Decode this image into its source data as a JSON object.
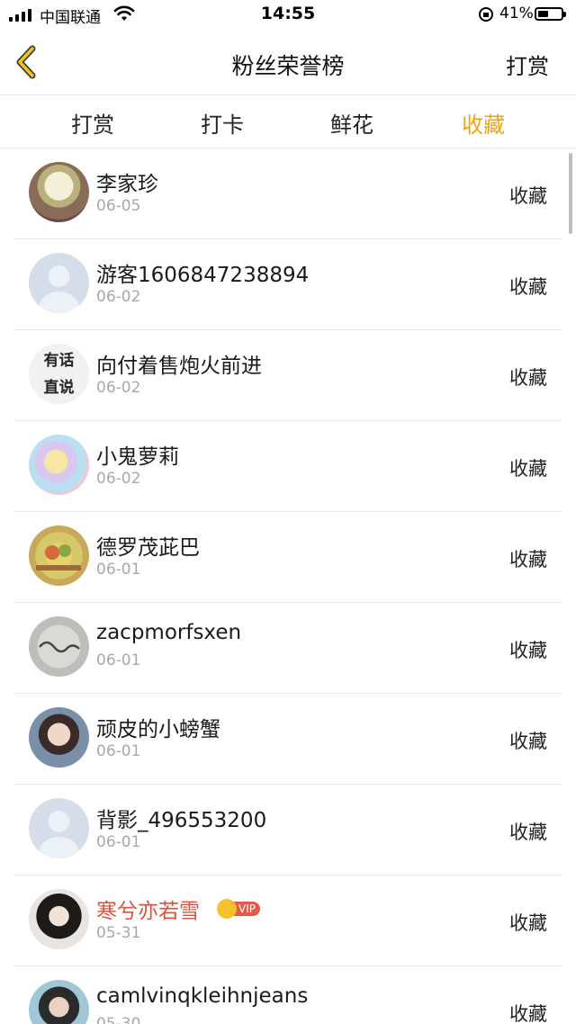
{
  "status_bar": {
    "carrier": "中国联通",
    "time": "14:55",
    "battery": "41%",
    "battery_level": 0.41
  },
  "nav": {
    "title": "粉丝荣誉榜",
    "right_action": "打赏",
    "back_icon": "chevron-left-icon",
    "accent_color": "#f0a40d"
  },
  "tabs": [
    {
      "label": "打赏"
    },
    {
      "label": "打卡"
    },
    {
      "label": "鲜花"
    },
    {
      "label": "收藏",
      "active": true
    }
  ],
  "list": [
    {
      "name": "李家珍",
      "date": "06-05",
      "action": "收藏"
    },
    {
      "name": "游客1606847238894",
      "date": "06-02",
      "action": "收藏"
    },
    {
      "name": "向付着售炮火前进",
      "date": "06-02",
      "action": "收藏",
      "avatar_text": [
        "有话",
        "直说"
      ]
    },
    {
      "name": "小鬼萝莉",
      "date": "06-02",
      "action": "收藏"
    },
    {
      "name": "德罗茂茈巴",
      "date": "06-01",
      "action": "收藏"
    },
    {
      "name": "zacpmorfsxen",
      "date": "06-01",
      "action": "收藏"
    },
    {
      "name": "顽皮的小螃蟹",
      "date": "06-01",
      "action": "收藏"
    },
    {
      "name": "背影_496553200",
      "date": "06-01",
      "action": "收藏"
    },
    {
      "name": "寒兮亦若雪",
      "date": "05-31",
      "action": "收藏",
      "vip": "VIP"
    },
    {
      "name": "camlvinqkleihnjeans",
      "date": "05-30",
      "action": "收藏"
    }
  ]
}
